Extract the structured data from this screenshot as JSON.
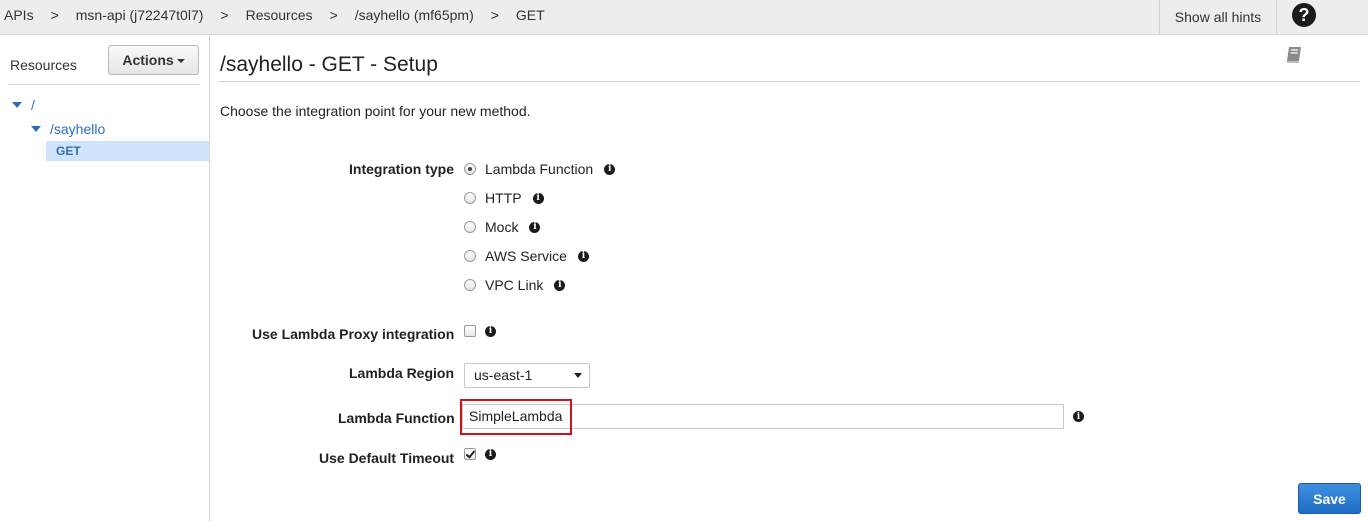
{
  "breadcrumbs": [
    "APIs",
    "msn-api (j72247t0l7)",
    "Resources",
    "/sayhello (mf65pm)",
    "GET"
  ],
  "breadcrumb_separator": ">",
  "topbar": {
    "hints_label": "Show all hints",
    "help_glyph": "?"
  },
  "sidebar": {
    "title": "Resources",
    "actions_label": "Actions",
    "tree": {
      "root": "/",
      "child": "/sayhello",
      "method": "GET"
    }
  },
  "main": {
    "title": "/sayhello - GET - Setup",
    "intro": "Choose the integration point for your new method.",
    "integration_type": {
      "label": "Integration type",
      "options": [
        "Lambda Function",
        "HTTP",
        "Mock",
        "AWS Service",
        "VPC Link"
      ],
      "selected": "Lambda Function"
    },
    "lambda_proxy": {
      "label": "Use Lambda Proxy integration",
      "checked": false
    },
    "lambda_region": {
      "label": "Lambda Region",
      "value": "us-east-1"
    },
    "lambda_function": {
      "label": "Lambda Function",
      "value": "SimpleLambda"
    },
    "default_timeout": {
      "label": "Use Default Timeout",
      "checked": true
    },
    "save_label": "Save"
  },
  "colors": {
    "link": "#2a6ebb",
    "selected_row": "#cfe4fb",
    "highlight": "#d0121b",
    "primary_button": "#1f6cc4"
  },
  "icons": [
    "help-icon",
    "book-icon",
    "info-icon",
    "caret-down-icon",
    "tree-expand-icon"
  ]
}
